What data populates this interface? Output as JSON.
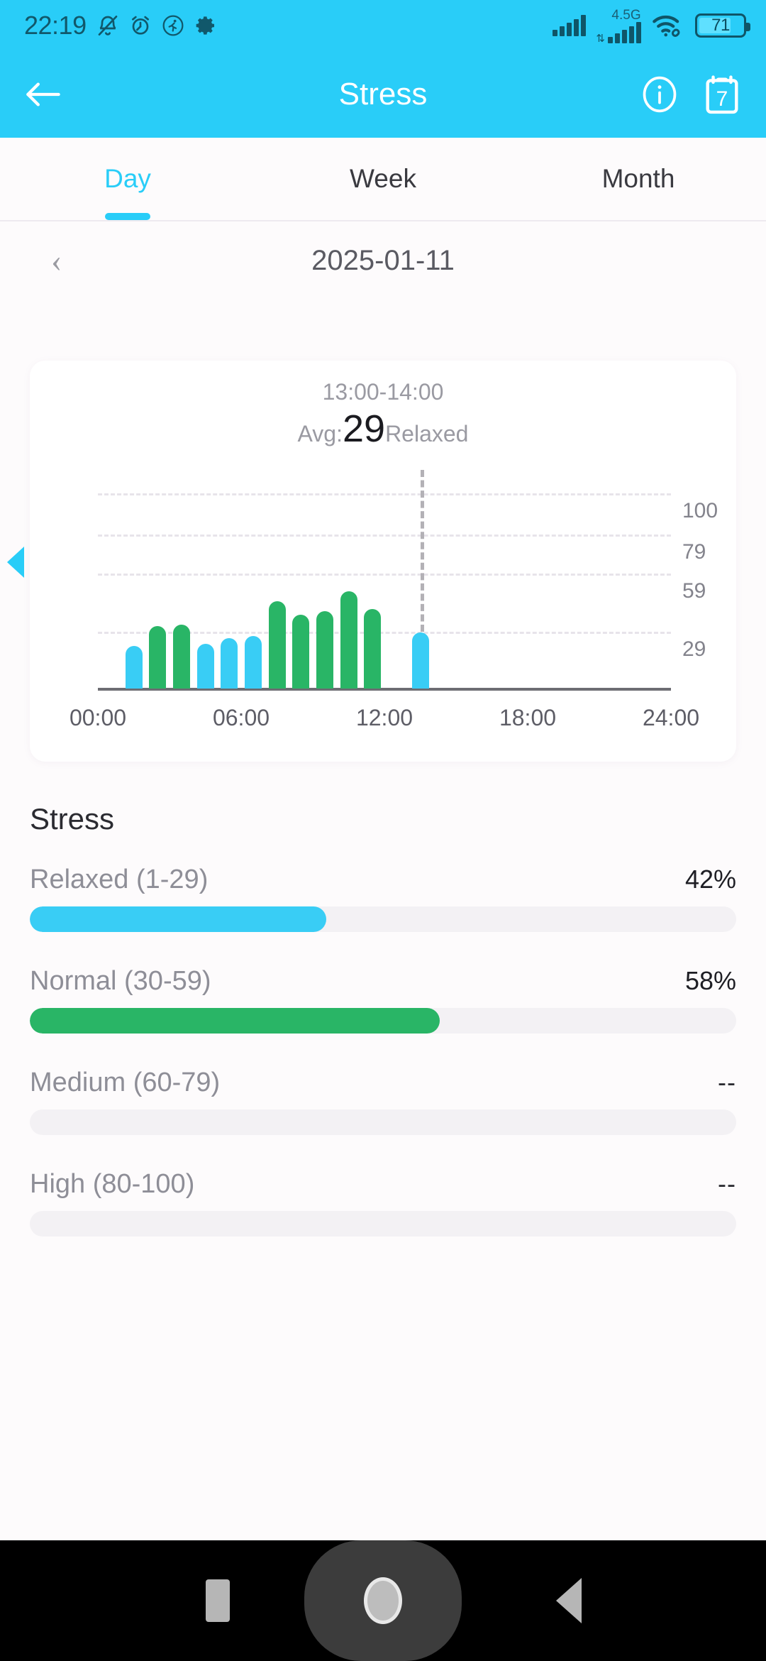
{
  "status_bar": {
    "time": "22:19",
    "left_icons": [
      "silent-bell-icon",
      "alarm-icon",
      "running-person-icon",
      "gear-icon"
    ],
    "network_label": "4.5G",
    "battery_percent": "71",
    "right_icons": [
      "signal-bars-icon",
      "signal-bars-4g-icon",
      "wifi-icon",
      "link-icon",
      "battery-icon"
    ]
  },
  "app_bar": {
    "back_icon": "arrow-left-icon",
    "title": "Stress",
    "info_icon": "info-circle-icon",
    "calendar_icon": "calendar-icon",
    "calendar_day": "7"
  },
  "tabs": {
    "items": [
      {
        "label": "Day",
        "active": true
      },
      {
        "label": "Week",
        "active": false
      },
      {
        "label": "Month",
        "active": false
      }
    ]
  },
  "date_nav": {
    "prev_icon": "chevron-left-icon",
    "date": "2025-01-11"
  },
  "chart_card": {
    "time_range": "13:00-14:00",
    "avg_prefix": "Avg:",
    "avg_value": "29",
    "avg_state": "Relaxed"
  },
  "chart_data": {
    "type": "bar",
    "title": "",
    "xlabel": "",
    "ylabel": "",
    "ylim": [
      0,
      110
    ],
    "grid": true,
    "yticks": [
      100,
      79,
      59,
      29
    ],
    "ytick_labels": [
      "100",
      "79",
      "59",
      "29"
    ],
    "xticks": [
      0,
      6,
      12,
      18,
      24
    ],
    "xtick_labels": [
      "00:00",
      "06:00",
      "12:00",
      "18:00",
      "24:00"
    ],
    "legend": "none",
    "x_unit": "hour",
    "cursor_hour": 13.5,
    "bars": [
      {
        "hour": 1.5,
        "value": 22,
        "level": "relaxed"
      },
      {
        "hour": 2.5,
        "value": 32,
        "level": "normal"
      },
      {
        "hour": 3.5,
        "value": 33,
        "level": "normal"
      },
      {
        "hour": 4.5,
        "value": 23,
        "level": "relaxed"
      },
      {
        "hour": 5.5,
        "value": 26,
        "level": "relaxed"
      },
      {
        "hour": 6.5,
        "value": 27,
        "level": "relaxed"
      },
      {
        "hour": 7.5,
        "value": 45,
        "level": "normal"
      },
      {
        "hour": 8.5,
        "value": 38,
        "level": "normal"
      },
      {
        "hour": 9.5,
        "value": 40,
        "level": "normal"
      },
      {
        "hour": 10.5,
        "value": 50,
        "level": "normal"
      },
      {
        "hour": 11.5,
        "value": 41,
        "level": "normal"
      },
      {
        "hour": 13.5,
        "value": 29,
        "level": "relaxed"
      }
    ],
    "colors": {
      "relaxed": "#39cdf5",
      "normal": "#29b566"
    }
  },
  "stress_section": {
    "heading": "Stress",
    "levels": [
      {
        "name": "Relaxed (1-29)",
        "percent_label": "42%",
        "percent": 42,
        "color": "#39cdf5",
        "empty": false
      },
      {
        "name": "Normal (30-59)",
        "percent_label": "58%",
        "percent": 58,
        "color": "#29b566",
        "empty": false
      },
      {
        "name": "Medium (60-79)",
        "percent_label": "--",
        "percent": 0,
        "color": "#f5a623",
        "empty": true
      },
      {
        "name": "High (80-100)",
        "percent_label": "--",
        "percent": 0,
        "color": "#e74c3c",
        "empty": true
      }
    ]
  },
  "edge_indicator": {
    "icon": "triangle-left-icon"
  },
  "nav_bar": {
    "recents_icon": "square-icon",
    "home_icon": "circle-icon",
    "back_icon": "triangle-back-icon"
  },
  "theme": {
    "accent": "#29cdf8",
    "green": "#29b566",
    "background": "#fdfbfc",
    "card": "#ffffff"
  }
}
